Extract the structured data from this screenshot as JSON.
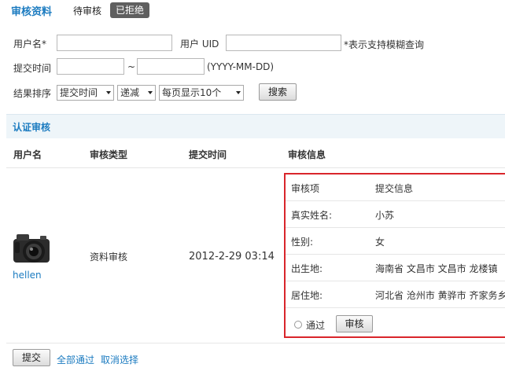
{
  "tabs": {
    "title": "审核资料",
    "pending": "待审核",
    "rejected": "已拒绝"
  },
  "filters": {
    "username_label": "用户名*",
    "uid_label": "用户 UID",
    "fuzzy_note": "*表示支持模糊查询",
    "date_label": "提交时间",
    "date_sep": "~",
    "date_format": "(YYYY-MM-DD)",
    "sort_label": "结果排序",
    "sort_field": "提交时间",
    "sort_order": "递减",
    "per_page": "每页显示10个",
    "search_button": "搜索"
  },
  "section": {
    "title": "认证审核"
  },
  "table": {
    "headers": [
      "用户名",
      "审核类型",
      "提交时间",
      "审核信息"
    ],
    "row": {
      "username": "hellen",
      "type": "资料审核",
      "submitted": "2012-2-29 03:14",
      "review": {
        "header_key": "审核项",
        "header_value": "提交信息",
        "items": [
          {
            "key": "真实姓名:",
            "value": "小苏"
          },
          {
            "key": "性别:",
            "value": "女"
          },
          {
            "key": "出生地:",
            "value": "海南省  文昌市  文昌市  龙楼镇"
          },
          {
            "key": "居住地:",
            "value": "河北省  沧州市  黄骅市  齐家务乡"
          }
        ],
        "pass_label": "通过",
        "audit_button": "审核"
      }
    }
  },
  "footer": {
    "submit": "提交",
    "pass_all": "全部通过",
    "cancel_select": "取消选择"
  },
  "colors": {
    "accent": "#1b7bc0",
    "highlight_border": "#d9252b",
    "tab_active": "#5f5f5f"
  }
}
